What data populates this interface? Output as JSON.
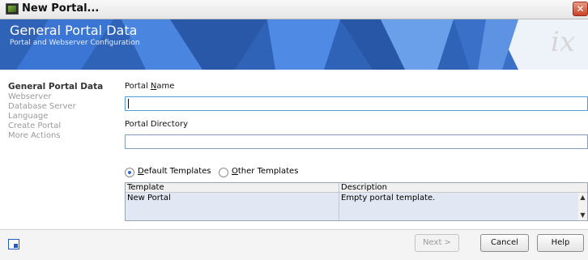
{
  "window": {
    "title": "New Portal...",
    "close_glyph": "✕"
  },
  "banner": {
    "title": "General Portal Data",
    "subtitle": "Portal and Webserver Configuration",
    "logo_text": "ix"
  },
  "steps": [
    "General Portal Data",
    "Webserver",
    "Database Server",
    "Language",
    "Create Portal",
    "More Actions"
  ],
  "form": {
    "portal_name": {
      "label_pre": "Portal ",
      "label_accel": "N",
      "label_post": "ame",
      "value": ""
    },
    "portal_directory": {
      "label": "Portal Directory",
      "value": ""
    },
    "templates": {
      "default": {
        "accel": "D",
        "rest": "efault Templates",
        "checked": true
      },
      "other": {
        "accel": "O",
        "rest": "ther Templates",
        "checked": false
      }
    },
    "grid": {
      "columns": [
        "Template",
        "Description"
      ],
      "rows": [
        {
          "template": "New Portal",
          "description": "Empty portal template."
        }
      ]
    }
  },
  "footer": {
    "icon": "save-window-icon",
    "buttons": {
      "next": "Next >",
      "cancel": "Cancel",
      "help": "Help"
    }
  },
  "colors": {
    "banner": "#2f63b8",
    "radio_dot": "#2a6ad8",
    "field_focus": "#5b9bd5"
  }
}
